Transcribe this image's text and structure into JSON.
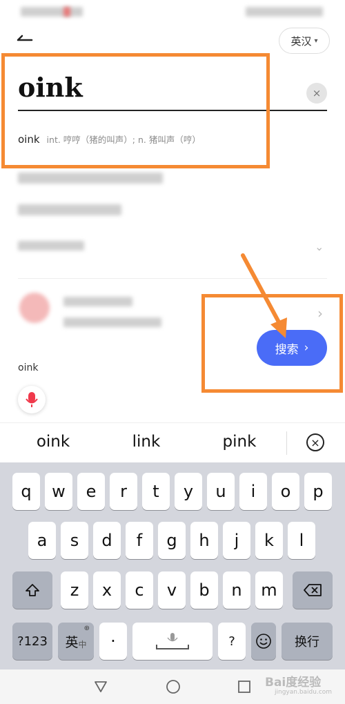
{
  "header": {
    "language_label": "英汉",
    "caret": "▾"
  },
  "search": {
    "query": "oink",
    "clear_symbol": "×"
  },
  "suggestion": {
    "word": "oink",
    "definition": "int. 哼哼（猪的叫声）; n. 猪叫声（哼）"
  },
  "search_button": {
    "label": "搜索",
    "chevron": "›"
  },
  "history": {
    "last_word": "oink"
  },
  "candidates": [
    "oink",
    "link",
    "pink"
  ],
  "keyboard": {
    "row1": [
      "q",
      "w",
      "e",
      "r",
      "t",
      "y",
      "u",
      "i",
      "o",
      "p"
    ],
    "row2": [
      "a",
      "s",
      "d",
      "f",
      "g",
      "h",
      "j",
      "k",
      "l"
    ],
    "row3": [
      "z",
      "x",
      "c",
      "v",
      "b",
      "n",
      "m"
    ],
    "num_key": "?123",
    "lang_key": "英",
    "lang_key_sub": "中",
    "dot_key": "·",
    "question_key": "?",
    "enter_key": "换行"
  },
  "watermark": {
    "text": "Bai度经验",
    "sub": "jingyan.baidu.com"
  },
  "colors": {
    "accent": "#4a6cf7",
    "annotation": "#f58a33",
    "mic": "#f0394b"
  },
  "icons": {
    "back": "back-arrow-icon",
    "mic": "microphone-icon",
    "shift": "shift-icon",
    "delete": "backspace-icon",
    "emoji": "emoji-icon",
    "globe": "globe-icon"
  }
}
